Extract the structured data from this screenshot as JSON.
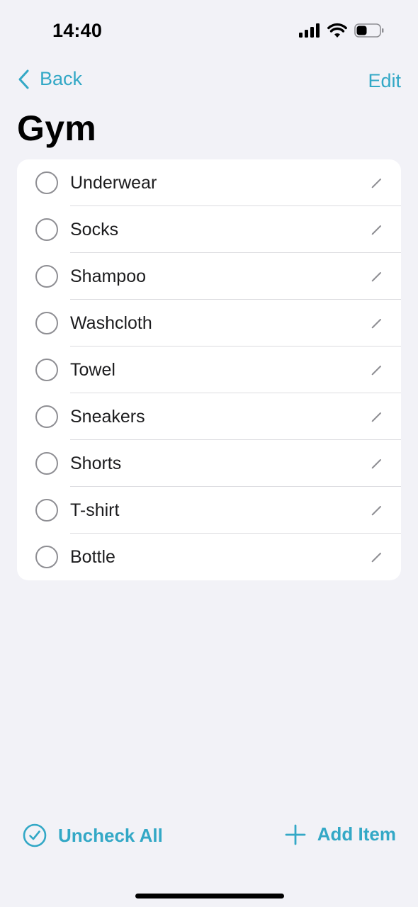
{
  "status_bar": {
    "time": "14:40",
    "icons": [
      "cellular-signal-icon",
      "wifi-icon",
      "battery-icon"
    ]
  },
  "nav": {
    "back_label": "Back",
    "edit_label": "Edit"
  },
  "page": {
    "title": "Gym"
  },
  "items": [
    {
      "label": "Underwear",
      "checked": false
    },
    {
      "label": "Socks",
      "checked": false
    },
    {
      "label": "Shampoo",
      "checked": false
    },
    {
      "label": "Washcloth",
      "checked": false
    },
    {
      "label": "Towel",
      "checked": false
    },
    {
      "label": "Sneakers",
      "checked": false
    },
    {
      "label": "Shorts",
      "checked": false
    },
    {
      "label": "T-shirt",
      "checked": false
    },
    {
      "label": "Bottle",
      "checked": false
    }
  ],
  "toolbar": {
    "uncheck_all_label": "Uncheck All",
    "add_item_label": "Add Item"
  },
  "colors": {
    "accent": "#33a8c6",
    "background": "#f2f2f7",
    "card": "#ffffff",
    "circle": "#8e8e93"
  }
}
